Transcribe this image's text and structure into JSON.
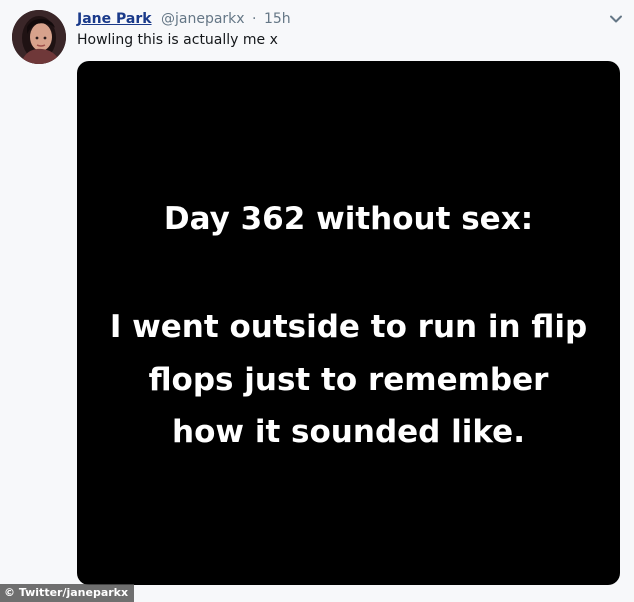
{
  "tweet": {
    "author": {
      "display_name": "Jane Park",
      "handle": "@janeparkx",
      "separator": "·",
      "timestamp": "15h"
    },
    "text": "Howling this is actually me x",
    "menu_icon": "chevron-down-icon",
    "media": {
      "lines": [
        "Day 362 without sex:",
        "I went outside to run in flip",
        "flops just to remember",
        "how it sounded like."
      ],
      "background_color": "#000000",
      "text_color": "#ffffff"
    }
  },
  "credit": {
    "text": "© Twitter/janeparkx"
  },
  "colors": {
    "page_background": "#f7f8fa",
    "name": "#1a3a8a",
    "secondary_text": "#657786"
  }
}
